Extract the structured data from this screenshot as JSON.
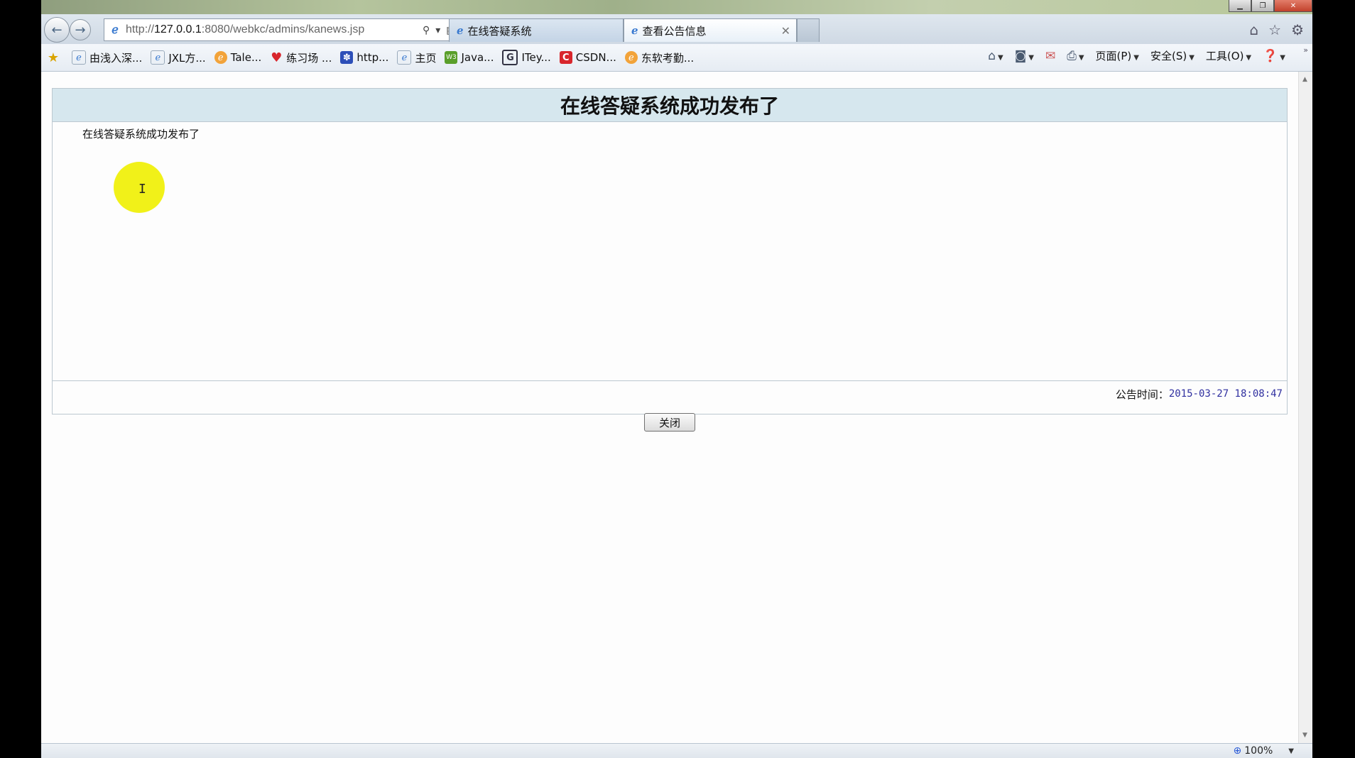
{
  "window": {
    "address": {
      "url_prefix": "http://",
      "url_host": "127.0.0.1",
      "url_rest": ":8080/webkc/admins/kanews.jsp"
    },
    "tabs": [
      {
        "label": "在线答疑系统"
      },
      {
        "label": "查看公告信息"
      }
    ]
  },
  "favorites": [
    {
      "label": "由浅入深...",
      "icon": "ie-page-icon"
    },
    {
      "label": "JXL方...",
      "icon": "ie-page-icon"
    },
    {
      "label": "Tale...",
      "icon": "orange-globe-icon"
    },
    {
      "label": "练习场 ...",
      "icon": "heart-icon"
    },
    {
      "label": "http...",
      "icon": "baidu-paw-icon"
    },
    {
      "label": "主页",
      "icon": "ie-page-icon"
    },
    {
      "label": "Java...",
      "icon": "w3c-icon"
    },
    {
      "label": "ITey...",
      "icon": "iteye-icon"
    },
    {
      "label": "CSDN...",
      "icon": "csdn-icon"
    },
    {
      "label": "东软考勤...",
      "icon": "orange-globe-icon"
    }
  ],
  "command_bar": {
    "page": "页面(P)",
    "safety": "安全(S)",
    "tools": "工具(O)"
  },
  "notice": {
    "title": "在线答疑系统成功发布了",
    "body": "在线答疑系统成功发布了",
    "time_label": "公告时间：",
    "time_value": "2015-03-27 18:08:47",
    "close_label": "关闭"
  },
  "status": {
    "zoom": "100%"
  }
}
